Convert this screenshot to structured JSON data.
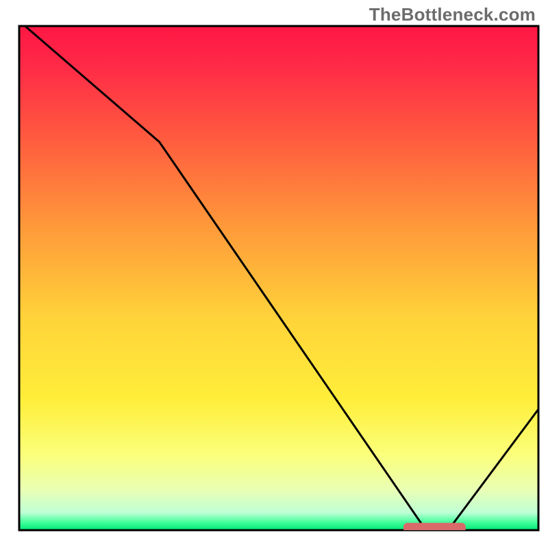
{
  "watermark": {
    "text": "TheBottleneck.com"
  },
  "chart_data": {
    "type": "line",
    "title": "",
    "xlabel": "",
    "ylabel": "",
    "xlim": [
      0,
      100
    ],
    "ylim": [
      0,
      100
    ],
    "x": [
      0,
      27,
      78,
      83,
      100
    ],
    "values": [
      101,
      77,
      0.5,
      0.5,
      24
    ],
    "marker": {
      "x_start": 74,
      "x_end": 86,
      "y": 0.5
    },
    "gradient_stops": [
      {
        "offset": 0,
        "color": "#ff1744"
      },
      {
        "offset": 0.08,
        "color": "#ff2a47"
      },
      {
        "offset": 0.22,
        "color": "#ff5a3f"
      },
      {
        "offset": 0.4,
        "color": "#ff9a3a"
      },
      {
        "offset": 0.58,
        "color": "#ffd33a"
      },
      {
        "offset": 0.74,
        "color": "#ffee3a"
      },
      {
        "offset": 0.85,
        "color": "#fbff7a"
      },
      {
        "offset": 0.92,
        "color": "#e9ffb4"
      },
      {
        "offset": 0.965,
        "color": "#bfffd6"
      },
      {
        "offset": 0.985,
        "color": "#3fff99"
      },
      {
        "offset": 1.0,
        "color": "#00e676"
      }
    ]
  }
}
